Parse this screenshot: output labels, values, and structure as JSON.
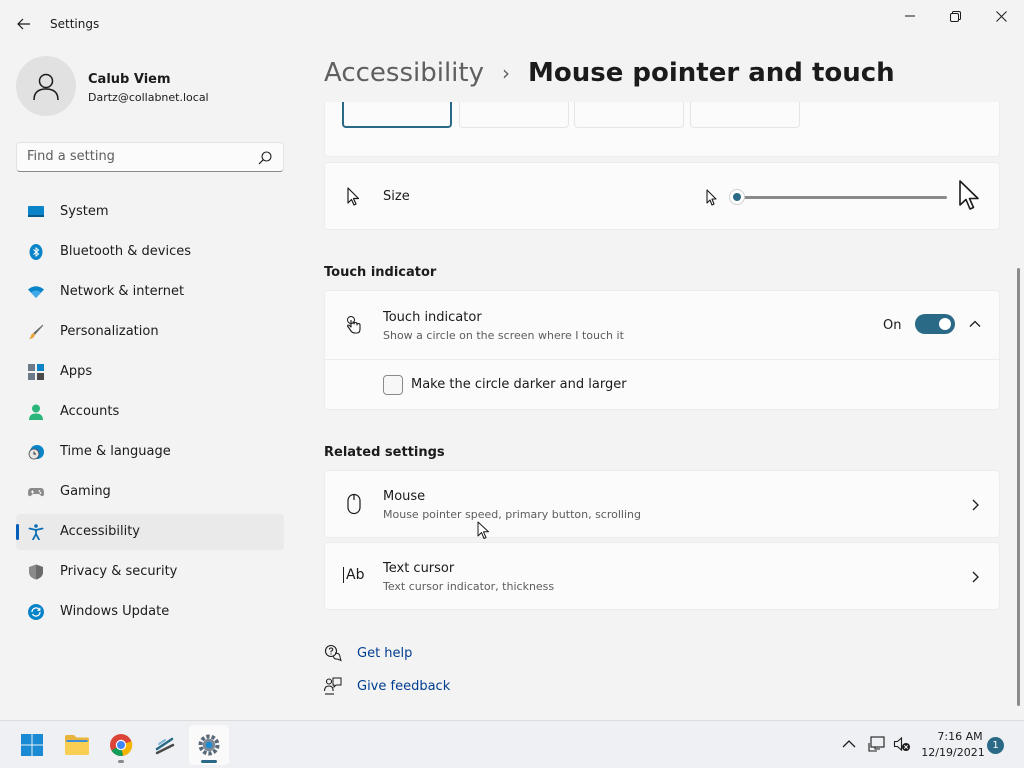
{
  "window": {
    "title": "Settings"
  },
  "profile": {
    "name": "Calub Viem",
    "email": "Dartz@collabnet.local"
  },
  "search": {
    "placeholder": "Find a setting"
  },
  "sidebar": {
    "items": [
      {
        "label": "System",
        "icon": "system-icon",
        "active": false
      },
      {
        "label": "Bluetooth & devices",
        "icon": "bluetooth-icon",
        "active": false
      },
      {
        "label": "Network & internet",
        "icon": "wifi-icon",
        "active": false
      },
      {
        "label": "Personalization",
        "icon": "brush-icon",
        "active": false
      },
      {
        "label": "Apps",
        "icon": "apps-icon",
        "active": false
      },
      {
        "label": "Accounts",
        "icon": "person-icon",
        "active": false
      },
      {
        "label": "Time & language",
        "icon": "clock-globe-icon",
        "active": false
      },
      {
        "label": "Gaming",
        "icon": "gamepad-icon",
        "active": false
      },
      {
        "label": "Accessibility",
        "icon": "accessibility-icon",
        "active": true
      },
      {
        "label": "Privacy & security",
        "icon": "shield-icon",
        "active": false
      },
      {
        "label": "Windows Update",
        "icon": "update-icon",
        "active": false
      }
    ]
  },
  "breadcrumb": {
    "parent": "Accessibility",
    "separator": "›",
    "current": "Mouse pointer and touch"
  },
  "pointer_size": {
    "label": "Size",
    "value_fraction": 0.0
  },
  "touch_section": {
    "heading": "Touch indicator",
    "title": "Touch indicator",
    "subtitle": "Show a circle on the screen where I touch it",
    "toggle_label": "On",
    "toggle_on": true,
    "checkbox_label": "Make the circle darker and larger",
    "checkbox_checked": false
  },
  "related": {
    "heading": "Related settings",
    "items": [
      {
        "title": "Mouse",
        "subtitle": "Mouse pointer speed, primary button, scrolling"
      },
      {
        "title": "Text cursor",
        "subtitle": "Text cursor indicator, thickness"
      }
    ],
    "text_cursor_icon_text": "Ab"
  },
  "help": {
    "get_help": "Get help",
    "give_feedback": "Give feedback"
  },
  "taskbar": {
    "time": "7:16 AM",
    "date": "12/19/2021",
    "notification_count": "1"
  },
  "colors": {
    "accent": "#2a6a86",
    "link": "#003e92",
    "active_nav_bar": "#005fb8"
  }
}
